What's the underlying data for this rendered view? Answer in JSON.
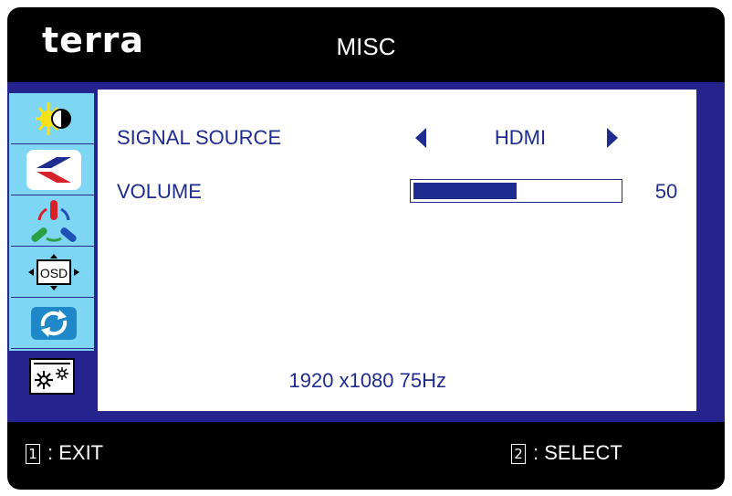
{
  "header": {
    "brand": "terra",
    "title": "MISC"
  },
  "sidebar": {
    "tabs": [
      {
        "icon": "brightness-contrast-icon"
      },
      {
        "icon": "image-position-icon"
      },
      {
        "icon": "color-icon"
      },
      {
        "icon": "osd-icon"
      },
      {
        "icon": "reset-icon"
      },
      {
        "icon": "misc-settings-icon",
        "active": true
      }
    ]
  },
  "main": {
    "signal_source": {
      "label": "SIGNAL SOURCE",
      "value": "HDMI"
    },
    "volume": {
      "label": "VOLUME",
      "value": "50",
      "level": 0.5
    },
    "resolution": "1920 x1080 75Hz"
  },
  "footer": {
    "exit": {
      "key": "1",
      "label": ": EXIT"
    },
    "select": {
      "key": "2",
      "label": ": SELECT"
    }
  },
  "colors": {
    "accent": "#1e2b8f",
    "panel": "#25248f",
    "sidebar": "#7fd5f4",
    "frame": "#000000"
  }
}
